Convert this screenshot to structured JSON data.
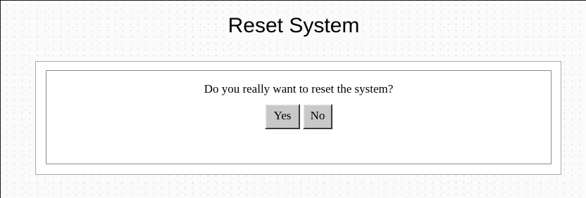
{
  "page": {
    "title": "Reset System"
  },
  "dialog": {
    "question": "Do you really want to reset the system?",
    "yes_label": "Yes",
    "no_label": "No"
  }
}
